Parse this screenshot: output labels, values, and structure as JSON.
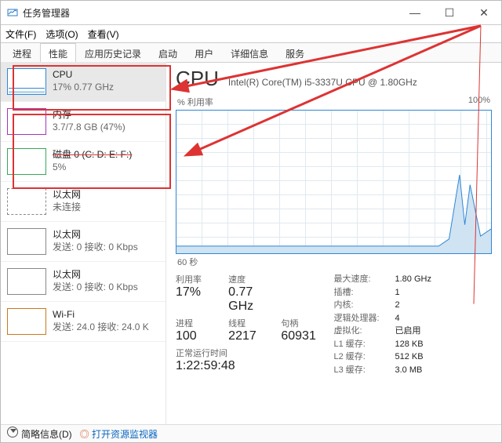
{
  "window": {
    "title": "任务管理器"
  },
  "menubar": {
    "file": "文件(F)",
    "options": "选项(O)",
    "view": "查看(V)"
  },
  "tabs": {
    "processes": "进程",
    "performance": "性能",
    "app_history": "应用历史记录",
    "startup": "启动",
    "users": "用户",
    "details": "详细信息",
    "services": "服务"
  },
  "sidebar": {
    "cpu": {
      "name": "CPU",
      "sub": "17% 0.77 GHz"
    },
    "mem": {
      "name": "内存",
      "sub": "3.7/7.8 GB (47%)"
    },
    "disk": {
      "name": "磁盘 0 (C: D: E: F:)",
      "sub": "5%"
    },
    "eth1": {
      "name": "以太网",
      "sub": "未连接"
    },
    "eth2": {
      "name": "以太网",
      "sub": "发送: 0 接收: 0 Kbps"
    },
    "eth3": {
      "name": "以太网",
      "sub": "发送: 0 接收: 0 Kbps"
    },
    "wifi": {
      "name": "Wi-Fi",
      "sub": "发送: 24.0 接收: 24.0 K"
    }
  },
  "main": {
    "title": "CPU",
    "sub": "Intel(R) Core(TM) i5-3337U CPU @ 1.80GHz",
    "chart": {
      "topleft": "% 利用率",
      "topright": "100%",
      "bottomleft": "60 秒"
    },
    "statsL": {
      "util_lbl": "利用率",
      "util_val": "17%",
      "speed_lbl": "速度",
      "speed_val": "0.77 GHz",
      "proc_lbl": "进程",
      "proc_val": "100",
      "thr_lbl": "线程",
      "thr_val": "2217",
      "hnd_lbl": "句柄",
      "hnd_val": "60931",
      "up_lbl": "正常运行时间",
      "up_val": "1:22:59:48"
    },
    "statsR": {
      "maxspd": {
        "k": "最大速度:",
        "v": "1.80 GHz"
      },
      "sockets": {
        "k": "插槽:",
        "v": "1"
      },
      "cores": {
        "k": "内核:",
        "v": "2"
      },
      "lps": {
        "k": "逻辑处理器:",
        "v": "4"
      },
      "virt": {
        "k": "虚拟化:",
        "v": "已启用"
      },
      "l1": {
        "k": "L1 缓存:",
        "v": "128 KB"
      },
      "l2": {
        "k": "L2 缓存:",
        "v": "512 KB"
      },
      "l3": {
        "k": "L3 缓存:",
        "v": "3.0 MB"
      }
    }
  },
  "footer": {
    "less": "简略信息(D)",
    "resmon": "打开资源监视器"
  },
  "chart_data": {
    "type": "line",
    "title": "% 利用率",
    "xlabel": "60 秒",
    "ylabel": "%",
    "ylim": [
      0,
      100
    ],
    "x": [
      0,
      5,
      10,
      15,
      20,
      25,
      30,
      35,
      40,
      45,
      50,
      52,
      54,
      55,
      56,
      58,
      60
    ],
    "values": [
      5,
      5,
      5,
      5,
      5,
      5,
      5,
      5,
      5,
      5,
      5,
      10,
      55,
      20,
      48,
      12,
      17
    ]
  }
}
